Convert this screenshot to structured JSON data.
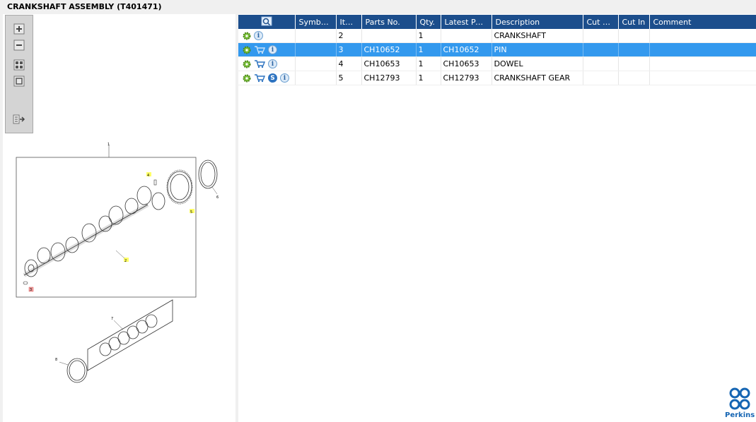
{
  "title": "CRANKSHAFT ASSEMBLY (T401471)",
  "zoom_tools": [
    {
      "name": "zoom-in-icon"
    },
    {
      "name": "zoom-out-icon"
    },
    {
      "name": "fit-all-icon"
    },
    {
      "name": "actual-size-icon"
    },
    {
      "name": "export-list-icon"
    }
  ],
  "diagram_callouts": [
    "1",
    "2",
    "3",
    "4",
    "5",
    "6",
    "7",
    "8"
  ],
  "table": {
    "columns": [
      "",
      "Symbol(s)",
      "Item",
      "Parts No.",
      "Qty.",
      "Latest Part...",
      "Description",
      "Cut Out",
      "Cut In",
      "Comment"
    ],
    "rows": [
      {
        "item": "2",
        "part_no": "",
        "qty": "1",
        "latest": "",
        "description": "CRANKSHAFT",
        "cut_out": "",
        "cut_in": "",
        "comment": "",
        "icons": [
          "gear-icon",
          "info-icon"
        ],
        "selected": false
      },
      {
        "item": "3",
        "part_no": "CH10652",
        "qty": "1",
        "latest": "CH10652",
        "description": "PIN",
        "cut_out": "",
        "cut_in": "",
        "comment": "",
        "icons": [
          "gear-icon",
          "cart-icon",
          "info-icon"
        ],
        "selected": true
      },
      {
        "item": "4",
        "part_no": "CH10653",
        "qty": "1",
        "latest": "CH10653",
        "description": "DOWEL",
        "cut_out": "",
        "cut_in": "",
        "comment": "",
        "icons": [
          "gear-icon",
          "cart-icon",
          "info-icon"
        ],
        "selected": false
      },
      {
        "item": "5",
        "part_no": "CH12793",
        "qty": "1",
        "latest": "CH12793",
        "description": "CRANKSHAFT GEAR",
        "cut_out": "",
        "cut_in": "",
        "comment": "",
        "icons": [
          "gear-icon",
          "cart-icon",
          "s-icon",
          "info-icon"
        ],
        "selected": false
      }
    ]
  },
  "logo_text": "Perkins",
  "colors": {
    "header": "#1c4e8c",
    "selected_row": "#3399ee",
    "brand": "#1565b3"
  }
}
